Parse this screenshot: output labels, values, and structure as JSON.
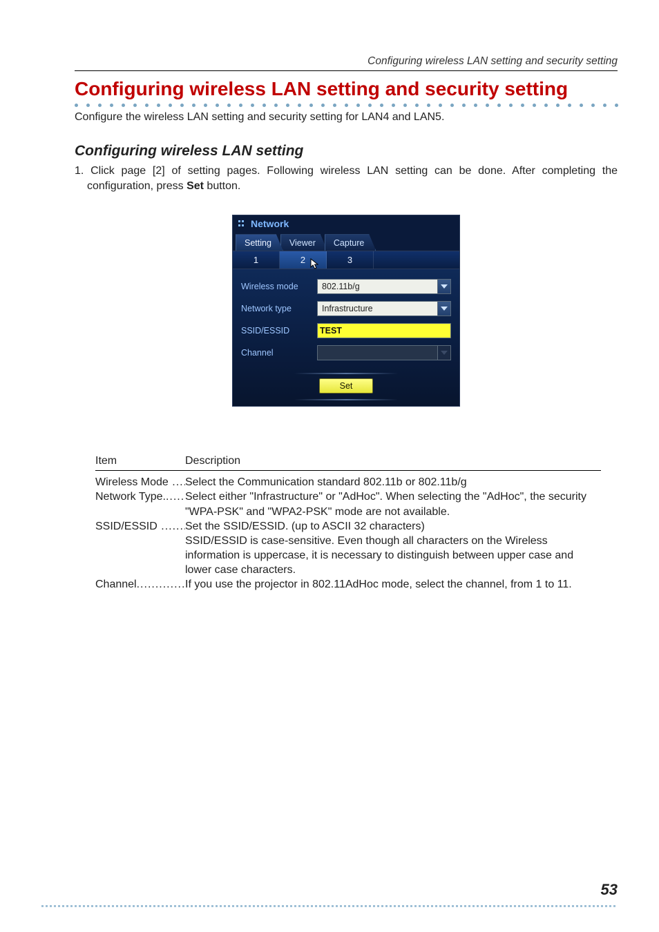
{
  "running_head": "Configuring wireless LAN setting and security setting",
  "title": "Configuring wireless LAN setting and security setting",
  "intro": "Configure the wireless LAN setting and security setting for LAN4 and LAN5.",
  "subhead": "Configuring wireless LAN setting",
  "step1_prefix": "1. ",
  "step1_a": "Click page [2] of setting pages. Following wireless LAN setting can be done. After completing the configuration, press ",
  "step1_bold": "Set",
  "step1_b": " button.",
  "panel": {
    "title": "Network",
    "tabs": {
      "setting": "Setting",
      "viewer": "Viewer",
      "capture": "Capture"
    },
    "subnav": {
      "p1": "1",
      "p2": "2",
      "p3": "3"
    },
    "labels": {
      "wireless_mode": "Wireless mode",
      "network_type": "Network type",
      "ssid": "SSID/ESSID",
      "channel": "Channel"
    },
    "values": {
      "wireless_mode": "802.11b/g",
      "network_type": "Infrastructure",
      "ssid": "TEST",
      "channel": ""
    },
    "set_button": "Set"
  },
  "desc": {
    "head_item": "Item",
    "head_desc": "Description",
    "rows": [
      {
        "item": "Wireless Mode",
        "dots": " ........",
        "text": "Select the Communication standard 802.11b or 802.11b/g",
        "cont": []
      },
      {
        "item": "Network Type.",
        "dots": ".........",
        "text": "Select either \"Infrastructure\" or \"AdHoc\". When selecting the \"AdHoc\", the security \"WPA-PSK\" and \"WPA2-PSK\" mode are not available.",
        "cont": []
      },
      {
        "item": "SSID/ESSID",
        "dots": " ...............",
        "text": "Set the SSID/ESSID. (up to ASCII 32 characters)",
        "cont": [
          "SSID/ESSID is case-sensitive. Even though all characters on the Wireless information is uppercase, it is necessary to distinguish between upper case and lower case characters."
        ]
      },
      {
        "item": "Channel",
        "dots": ".....................",
        "text": "If you use the projector in 802.11AdHoc mode, select the channel, from 1 to 11.",
        "cont": []
      }
    ]
  },
  "page_number": "53"
}
